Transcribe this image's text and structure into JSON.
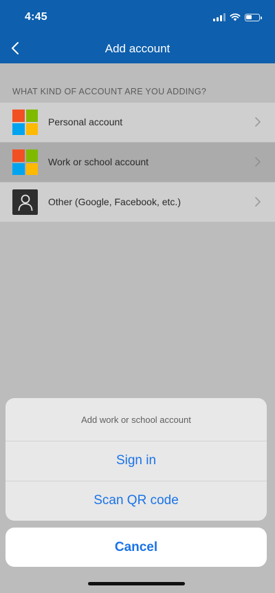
{
  "status_bar": {
    "time": "4:45",
    "icons": [
      "cellular-signal-icon",
      "wifi-icon",
      "battery-icon"
    ]
  },
  "nav": {
    "title": "Add account",
    "back_icon": "chevron-left-icon"
  },
  "section": {
    "header": "WHAT KIND OF ACCOUNT ARE YOU ADDING?"
  },
  "accounts": [
    {
      "label": "Personal account",
      "icon": "microsoft-logo-icon",
      "selected": false
    },
    {
      "label": "Work or school account",
      "icon": "microsoft-logo-icon",
      "selected": true
    },
    {
      "label": "Other (Google, Facebook, etc.)",
      "icon": "person-icon",
      "selected": false
    }
  ],
  "action_sheet": {
    "title": "Add work or school account",
    "actions": [
      "Sign in",
      "Scan QR code"
    ],
    "cancel": "Cancel"
  },
  "colors": {
    "header_bg": "#0e5fad",
    "action_blue": "#1a73e8",
    "ms_red": "#f25022",
    "ms_green": "#7fba00",
    "ms_blue": "#00a4ef",
    "ms_yellow": "#ffb900"
  }
}
